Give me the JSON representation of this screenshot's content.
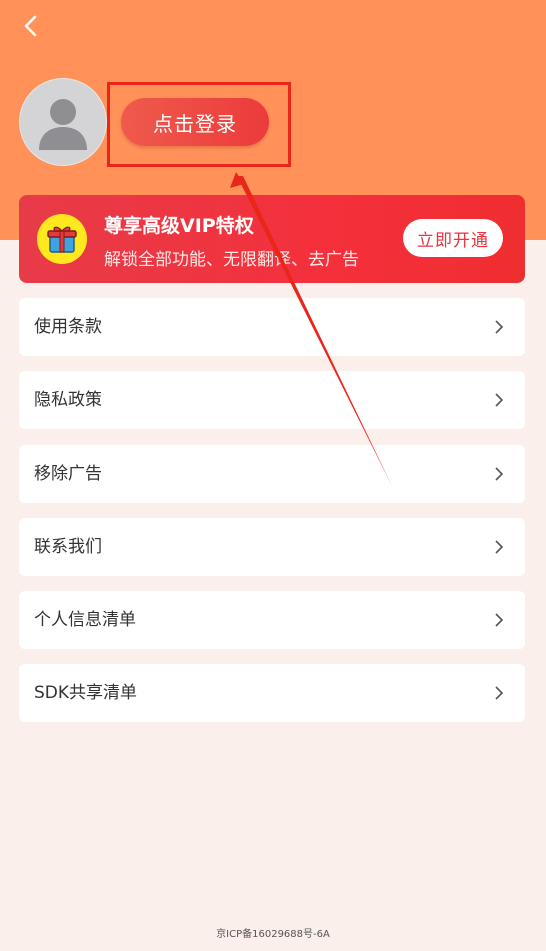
{
  "header": {
    "back_icon": "chevron-left-icon",
    "avatar_icon": "default-user-avatar-icon",
    "login_label": "点击登录",
    "background_color": "#ff9159"
  },
  "vip": {
    "icon": "gift-icon",
    "title": "尊享高级VIP特权",
    "subtitle": "解锁全部功能、无限翻译、去广告",
    "button_label": "立即开通",
    "accent_color": "#ec3b3b"
  },
  "menu": [
    {
      "label": "使用条款"
    },
    {
      "label": "隐私政策"
    },
    {
      "label": "移除广告"
    },
    {
      "label": "联系我们"
    },
    {
      "label": "个人信息清单"
    },
    {
      "label": "SDK共享清单"
    }
  ],
  "footer": {
    "icp": "京ICP备16029688号-6A"
  },
  "annotation": {
    "highlight_color": "#e8261a"
  }
}
